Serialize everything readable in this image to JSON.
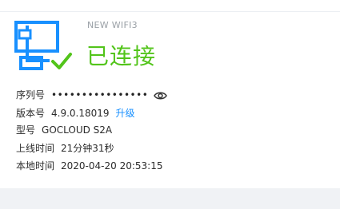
{
  "device": {
    "ssid": "NEW WIFI3",
    "status": "已连接",
    "icon": "router-connected-icon",
    "status_color": "#52c41a",
    "icon_color": "#1890ff"
  },
  "info": {
    "serial_label": "序列号",
    "serial_value": "••••••••••••••••",
    "version_label": "版本号",
    "version_value": "4.9.0.18019",
    "upgrade_label": "升级",
    "model_label": "型号",
    "model_value": "GOCLOUD S2A",
    "uptime_label": "上线时间",
    "uptime_value": "21分钟31秒",
    "time_label": "本地时间",
    "time_value": "2020-04-20 20:53:15"
  }
}
